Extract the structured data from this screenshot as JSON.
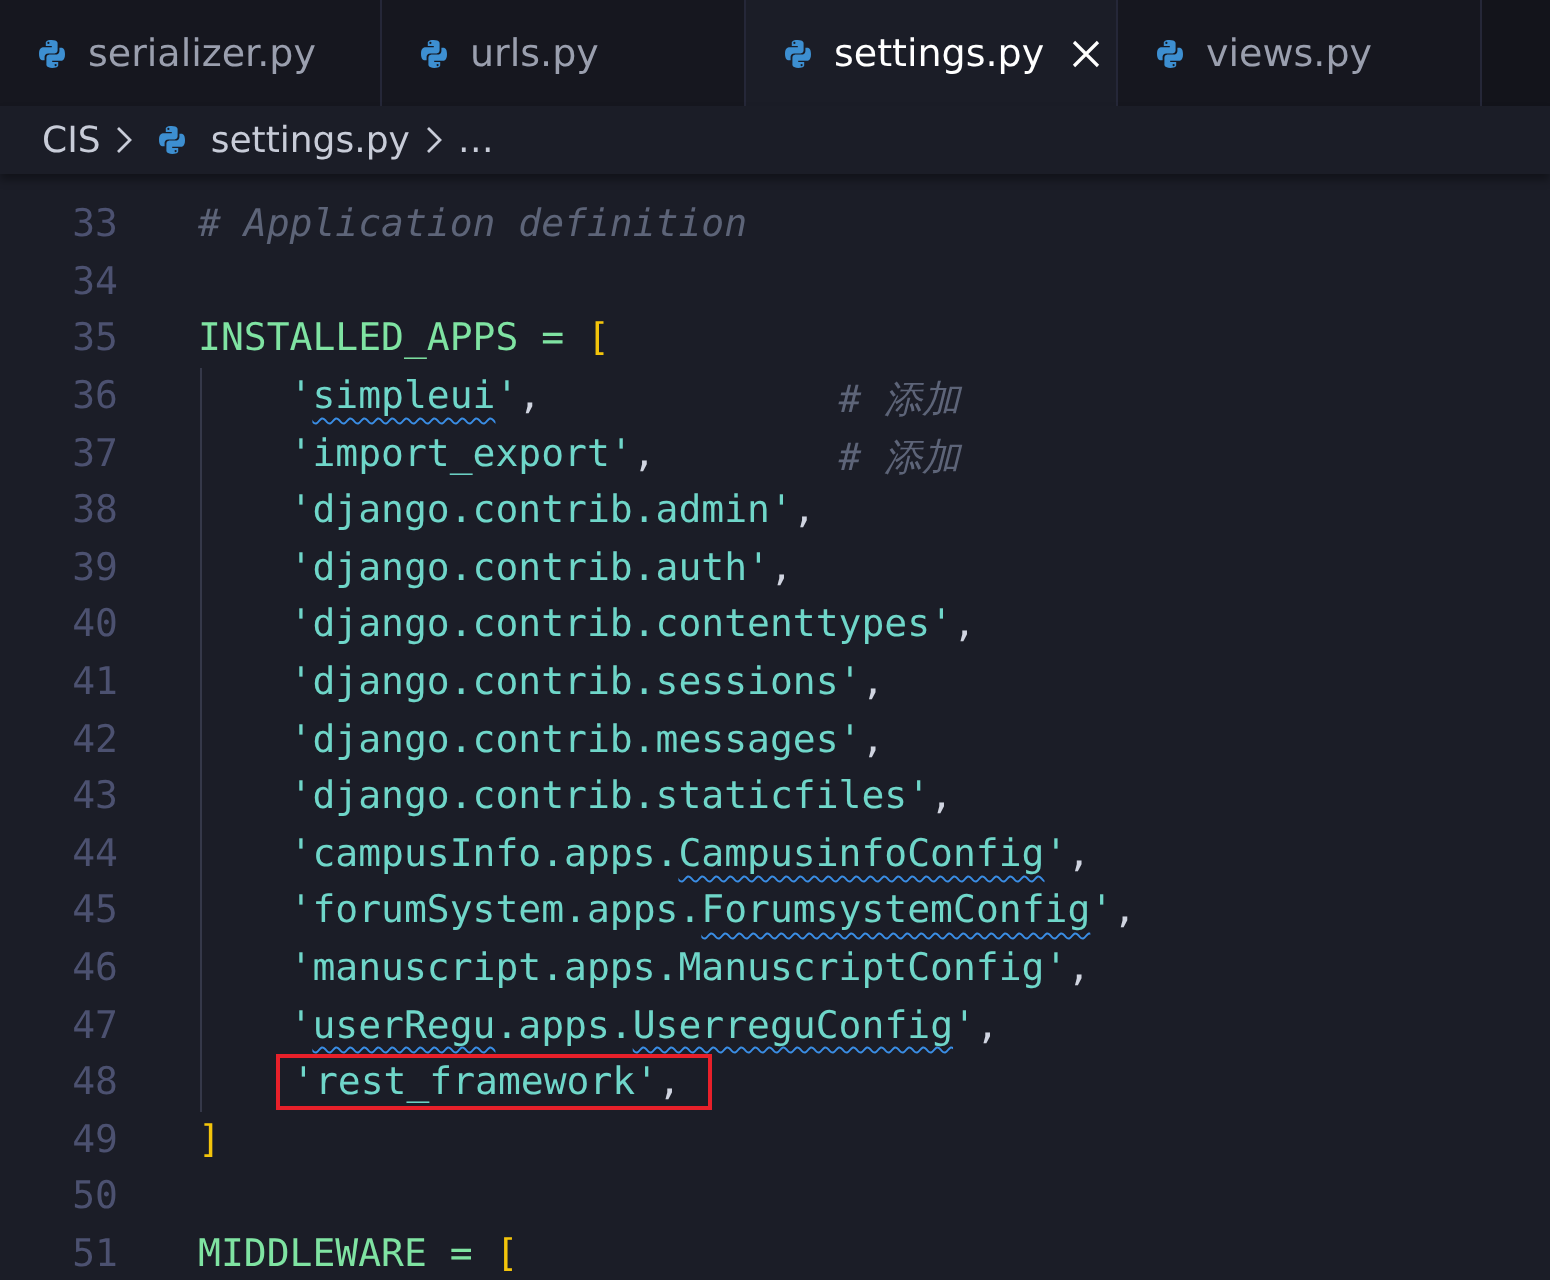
{
  "tabs": [
    {
      "label": "serializer.py",
      "selected": false
    },
    {
      "label": "urls.py",
      "selected": false
    },
    {
      "label": "settings.py",
      "selected": true
    },
    {
      "label": "views.py",
      "selected": false
    }
  ],
  "breadcrumb": {
    "folder": "CIS",
    "file": "settings.py",
    "more": "…"
  },
  "lines": [
    {
      "number": "33",
      "tokens": [
        {
          "kind": "comment",
          "text": "# Application definition"
        }
      ]
    },
    {
      "number": "34"
    },
    {
      "number": "35",
      "tokens": [
        {
          "kind": "ident",
          "text": "INSTALLED_APPS ="
        },
        {
          "kind": "bracket",
          "text": "["
        }
      ]
    },
    {
      "number": "36",
      "tokens": [
        {
          "kind": "str",
          "text": "    '"
        },
        {
          "kind": "flagged",
          "text": "simpleui"
        },
        {
          "kind": "str",
          "text": "'"
        },
        {
          "kind": "punct",
          "text": ","
        },
        {
          "kind": "comment",
          "text": "# 添加"
        }
      ]
    },
    {
      "number": "37",
      "tokens": [
        {
          "kind": "str",
          "text": "    'import_export'"
        },
        {
          "kind": "punct",
          "text": ","
        },
        {
          "kind": "comment",
          "text": "# 添加"
        }
      ]
    },
    {
      "number": "38",
      "tokens": [
        {
          "kind": "str",
          "text": "    'django.contrib.admin'"
        },
        {
          "kind": "punct",
          "text": ","
        }
      ]
    },
    {
      "number": "39",
      "tokens": [
        {
          "kind": "str",
          "text": "    'django.contrib.auth'"
        },
        {
          "kind": "punct",
          "text": ","
        }
      ]
    },
    {
      "number": "40",
      "tokens": [
        {
          "kind": "str",
          "text": "    'django.contrib.contenttypes'"
        },
        {
          "kind": "punct",
          "text": ","
        }
      ]
    },
    {
      "number": "41",
      "tokens": [
        {
          "kind": "str",
          "text": "    'django.contrib.sessions'"
        },
        {
          "kind": "punct",
          "text": ","
        }
      ]
    },
    {
      "number": "42",
      "tokens": [
        {
          "kind": "str",
          "text": "    'django.contrib.messages'"
        },
        {
          "kind": "punct",
          "text": ","
        }
      ]
    },
    {
      "number": "43",
      "tokens": [
        {
          "kind": "str",
          "text": "    'django.contrib.staticfiles'"
        },
        {
          "kind": "punct",
          "text": ","
        }
      ]
    },
    {
      "number": "44",
      "tokens": [
        {
          "kind": "str",
          "text": "    'campusInfo.apps."
        },
        {
          "kind": "flagged",
          "text": "CampusinfoConfig"
        },
        {
          "kind": "str",
          "text": "'"
        },
        {
          "kind": "punct",
          "text": ","
        }
      ]
    },
    {
      "number": "45",
      "tokens": [
        {
          "kind": "str",
          "text": "    'forumSystem.apps."
        },
        {
          "kind": "flagged",
          "text": "ForumsystemConfig"
        },
        {
          "kind": "str",
          "text": "'"
        },
        {
          "kind": "punct",
          "text": ","
        }
      ]
    },
    {
      "number": "46",
      "tokens": [
        {
          "kind": "str",
          "text": "    'manuscript.apps.ManuscriptConfig'"
        },
        {
          "kind": "punct",
          "text": ","
        }
      ]
    },
    {
      "number": "47",
      "tokens": [
        {
          "kind": "str",
          "text": "    '"
        },
        {
          "kind": "flagged",
          "text": "userRegu"
        },
        {
          "kind": "str",
          "text": ".apps."
        },
        {
          "kind": "flagged",
          "text": "UserreguConfig"
        },
        {
          "kind": "str",
          "text": "'"
        },
        {
          "kind": "punct",
          "text": ","
        }
      ]
    },
    {
      "number": "48",
      "boxed": true,
      "tokens": [
        {
          "kind": "str",
          "text": "'rest_framework'"
        },
        {
          "kind": "punct",
          "text": ","
        }
      ]
    },
    {
      "number": "49",
      "tokens": [
        {
          "kind": "bracket",
          "text": "]"
        }
      ]
    },
    {
      "number": "50"
    },
    {
      "number": "51",
      "tokens": [
        {
          "kind": "ident",
          "text": "MIDDLEWARE ="
        },
        {
          "kind": "bracket",
          "text": "["
        }
      ]
    }
  ]
}
